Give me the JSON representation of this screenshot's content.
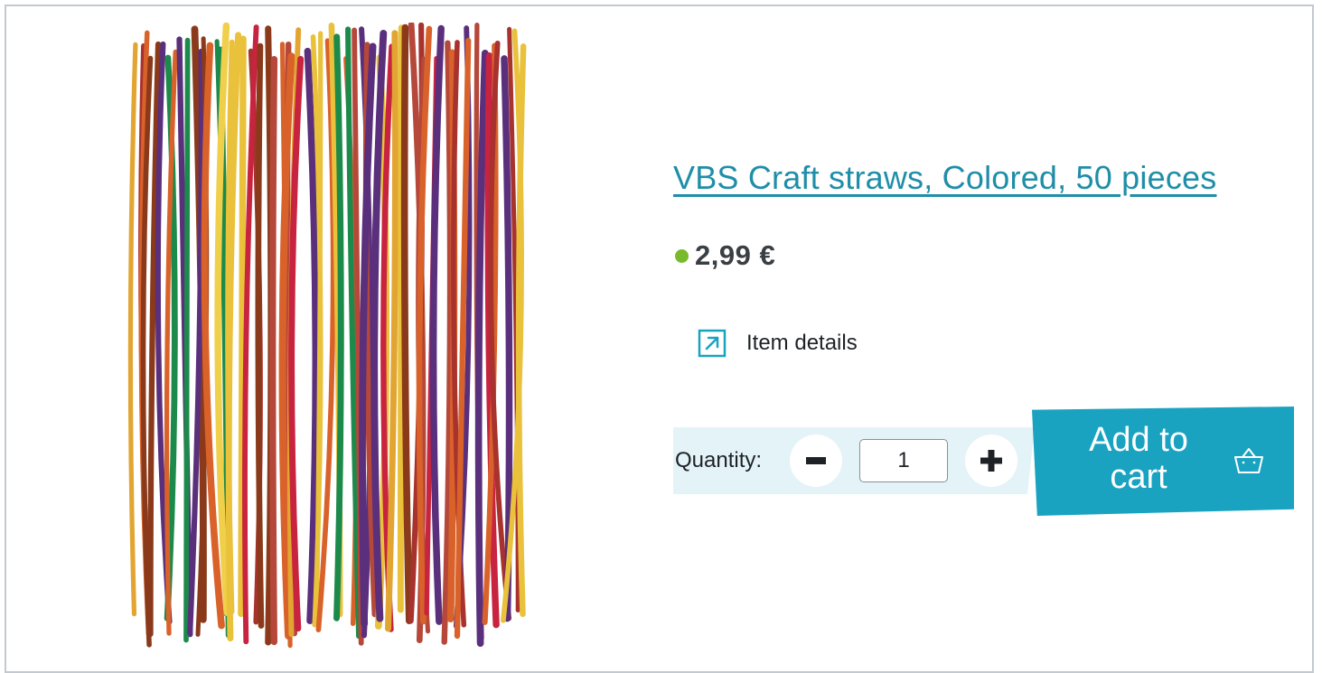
{
  "product": {
    "title": "VBS Craft straws, Colored, 50 pieces",
    "price": "2,99 €",
    "availability_color": "#79b92c",
    "image_icon": "colored-craft-straws-photo"
  },
  "details": {
    "label": "Item details",
    "icon": "external-link-arrow-icon"
  },
  "quantity": {
    "label": "Quantity:",
    "value": "1",
    "decrement_icon": "minus-icon",
    "increment_icon": "plus-icon"
  },
  "cart": {
    "label": "Add to cart",
    "icon": "basket-icon"
  },
  "colors": {
    "accent": "#1aa3c1",
    "link": "#1f8ea8",
    "quantity_band": "#e3f3f8",
    "border": "#c3c9d0"
  }
}
